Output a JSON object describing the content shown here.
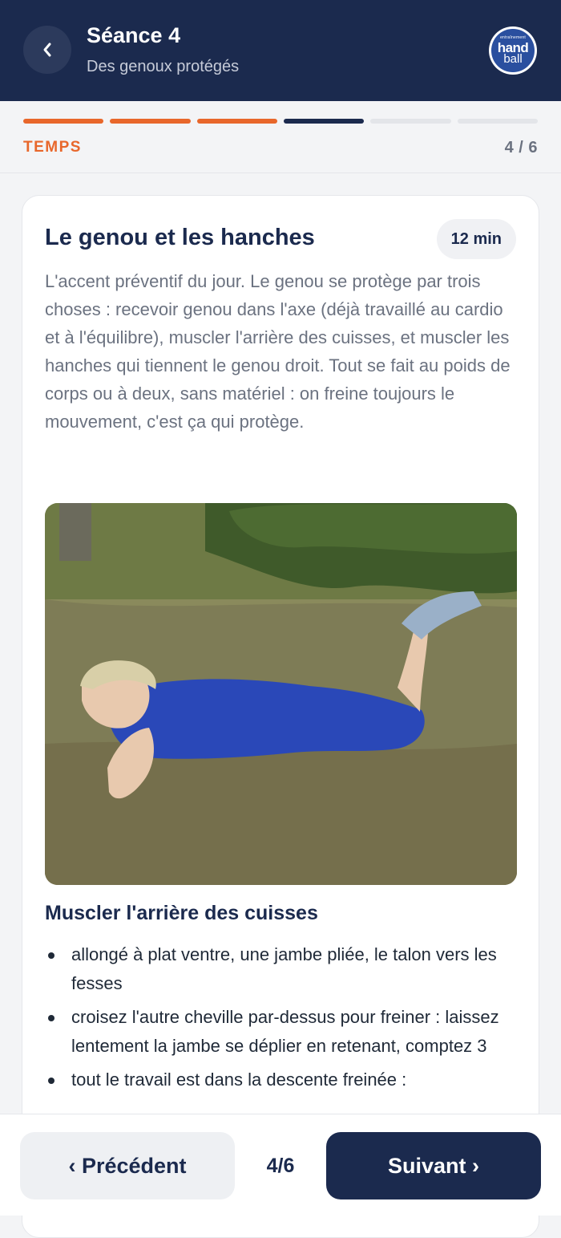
{
  "header": {
    "title": "Séance 4",
    "subtitle": "Des genoux protégés",
    "back_icon": "chevron-left-icon",
    "logo": {
      "small_text": "entraînement",
      "word1": "hand",
      "word2": "ball"
    },
    "background": "#1b2a4e"
  },
  "progress": {
    "label": "TEMPS",
    "count": "4 / 6",
    "current": 4,
    "total": 6,
    "segments": [
      "done",
      "done",
      "done",
      "current",
      "todo",
      "todo"
    ],
    "accent": "#e8672b"
  },
  "card": {
    "title": "Le genou et les hanches",
    "duration": "12 min",
    "intro": "L'accent préventif du jour. Le genou se protège par trois choses : recevoir genou dans l'axe (déjà travaillé au cardio et à l'équilibre), muscler l'arrière des cuisses, et muscler les hanches qui tiennent le genou droit. Tout se fait au poids de corps ou à deux, sans matériel : on freine toujours le mouvement, c'est ça qui protège.",
    "photo": "Joueur allongé sur le ventre dans l'herbe, une jambe pliée",
    "section_title": "Muscler l'arrière des cuisses",
    "bullets": [
      "allongé à plat ventre, une jambe pliée, le talon vers les fesses",
      "croisez l'autre cheville par-dessus pour freiner : laissez lentement la jambe se déplier en retenant, comptez 3",
      "tout le travail est dans la descente freinée :"
    ]
  },
  "footer": {
    "prev_label": "‹ Précédent",
    "count": "4/6",
    "next_label": "Suivant ›"
  }
}
